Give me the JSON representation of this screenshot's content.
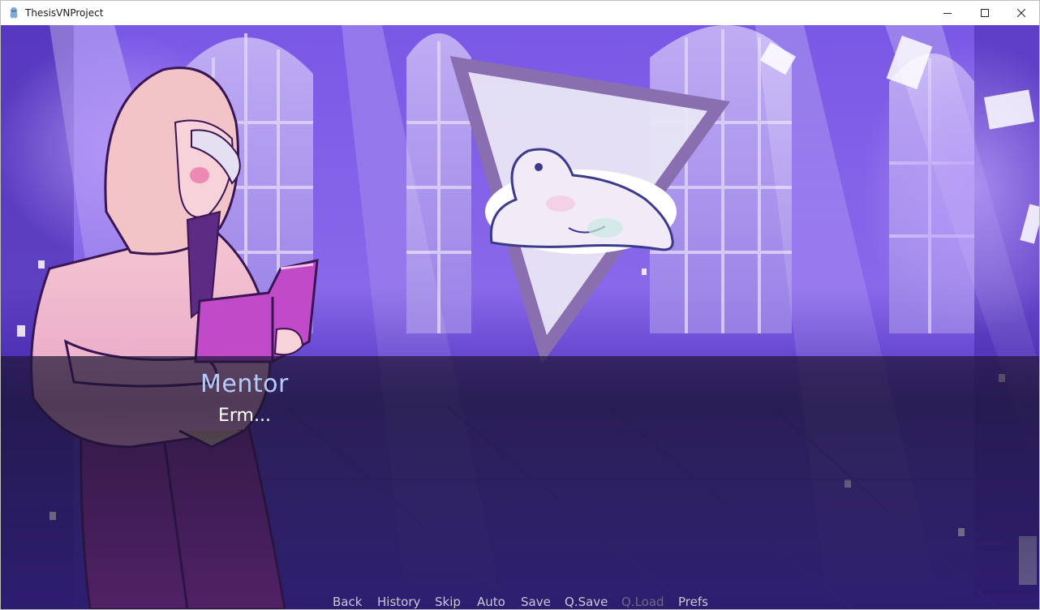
{
  "window": {
    "title": "ThesisVNProject",
    "app_icon": "renpy-icon",
    "controls": [
      "minimize-icon",
      "maximize-icon",
      "close-icon"
    ]
  },
  "dialogue": {
    "speaker": "Mentor",
    "text": "Erm..."
  },
  "quick_menu": {
    "back": "Back",
    "history": "History",
    "skip": "Skip",
    "auto": "Auto",
    "save": "Save",
    "qsave": "Q.Save",
    "qload": "Q.Load",
    "prefs": "Prefs"
  },
  "colors": {
    "speaker_name": "#b4ccfb",
    "dialogue_text": "#ffffff",
    "quick_menu_text": "#c9c9d4",
    "quick_menu_disabled": "#6e6a85",
    "scene_purple": "#6a46d8"
  }
}
